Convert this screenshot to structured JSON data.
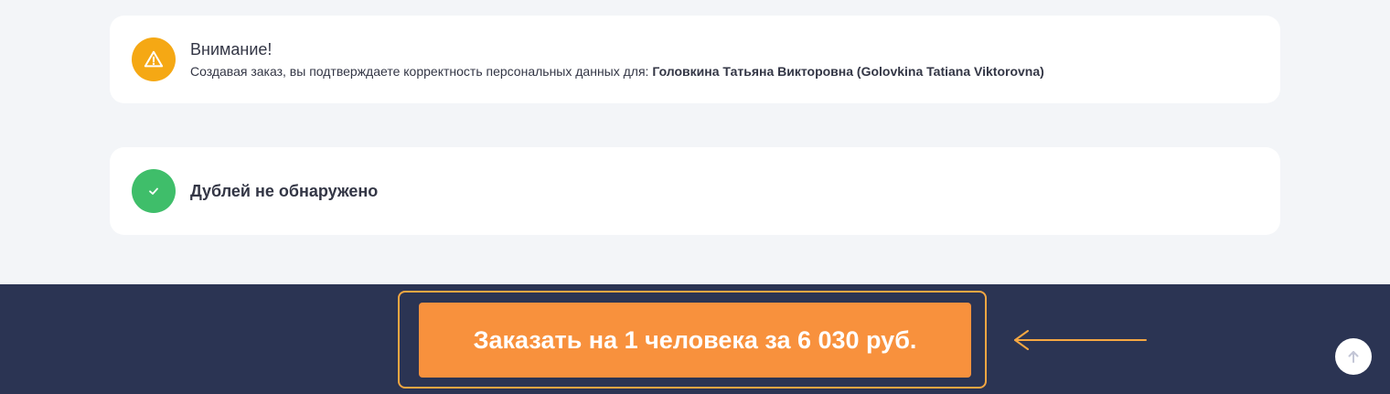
{
  "warning_card": {
    "title": "Внимание!",
    "text_prefix": "Создавая заказ, вы подтверждаете корректность персональных данных для: ",
    "person_name": "Головкина Татьяна Викторовна (Golovkina Tatiana Viktorovna)",
    "icon": "warning-triangle-icon",
    "icon_color": "#f5a814"
  },
  "duplicates_card": {
    "title": "Дублей не обнаружено",
    "icon": "checkmark-icon",
    "icon_color": "#3fbe6a"
  },
  "footer": {
    "order_button_label": "Заказать на 1 человека за 6 030 руб.",
    "button_color": "#f8913d",
    "highlight_color": "#f5a742",
    "background_color": "#2b3453",
    "scroll_top_icon": "arrow-up-icon"
  }
}
